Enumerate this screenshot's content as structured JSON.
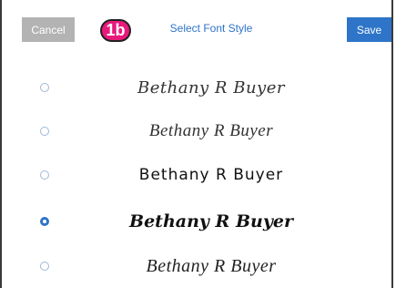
{
  "header": {
    "cancel_label": "Cancel",
    "step_badge": "1b",
    "title": "Select Font Style",
    "save_label": "Save"
  },
  "font_options": [
    {
      "text": "Bethany R Buyer",
      "selected": false
    },
    {
      "text": "Bethany R Buyer",
      "selected": false
    },
    {
      "text": "Bethany R Buyer",
      "selected": false
    },
    {
      "text": "Bethany R Buyer",
      "selected": true
    },
    {
      "text": "Bethany R Buyer",
      "selected": false
    }
  ],
  "colors": {
    "accent": "#2e74c8",
    "cancel_bg": "#b3b3b3",
    "badge": "#e8197c",
    "title": "#2f73c9"
  }
}
